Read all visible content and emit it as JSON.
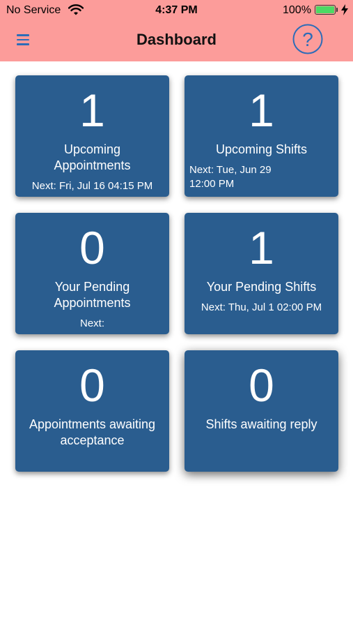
{
  "status_bar": {
    "carrier": "No Service",
    "time": "4:37 PM",
    "battery_percent": "100%",
    "battery_level": 1.0
  },
  "navbar": {
    "title": "Dashboard",
    "help_symbol": "?"
  },
  "colors": {
    "header_bg": "#fc9c9a",
    "tile_bg": "#2a5d8f",
    "accent": "#2d6cb8",
    "battery_green": "#4cd964"
  },
  "tiles": [
    {
      "count": "1",
      "label": "Upcoming Appointments",
      "next": "Next: Fri, Jul 16 04:15 PM"
    },
    {
      "count": "1",
      "label": "Upcoming Shifts",
      "next": "Next: Tue, Jun 29 12:00 PM"
    },
    {
      "count": "0",
      "label": "Your Pending Appointments",
      "next": "Next:"
    },
    {
      "count": "1",
      "label": "Your Pending Shifts",
      "next": "Next: Thu, Jul 1 02:00 PM"
    },
    {
      "count": "0",
      "label": "Appointments awaiting acceptance"
    },
    {
      "count": "0",
      "label": "Shifts awaiting reply"
    }
  ]
}
